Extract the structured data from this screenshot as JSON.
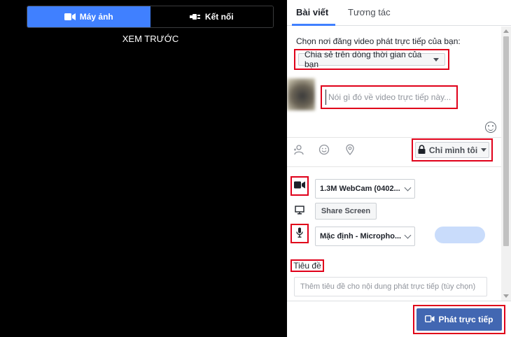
{
  "preview": {
    "source_tabs": [
      {
        "label": "Máy ảnh",
        "icon": "video-camera-icon",
        "active": true
      },
      {
        "label": "Kết nối",
        "icon": "plug-icon",
        "active": false
      }
    ],
    "preview_label": "XEM TRƯỚC"
  },
  "composer": {
    "tabs": [
      {
        "label": "Bài viết",
        "active": true
      },
      {
        "label": "Tương tác",
        "active": false
      }
    ],
    "where_label": "Chọn nơi đăng video phát trực tiếp của bạn:",
    "destination": "Chia sẻ trên dòng thời gian của bạn",
    "post_placeholder": "Nói gì đó về video trực tiếp này...",
    "privacy_label": "Chỉ mình tôi",
    "camera_select": "1.3M WebCam (0402...",
    "share_screen_label": "Share Screen",
    "mic_select": "Mặc định - Micropho...",
    "title_label": "Tiêu đề",
    "title_placeholder": "Thêm tiêu đề cho nội dung phát trực tiếp (tùy chọn)",
    "go_live_label": "Phát trực tiếp",
    "toolbar_icons": [
      "tag-people-icon",
      "feeling-icon",
      "location-pin-icon"
    ]
  },
  "colors": {
    "accent": "#4080ff",
    "go_live": "#4267b2",
    "highlight": "#e0001a"
  }
}
